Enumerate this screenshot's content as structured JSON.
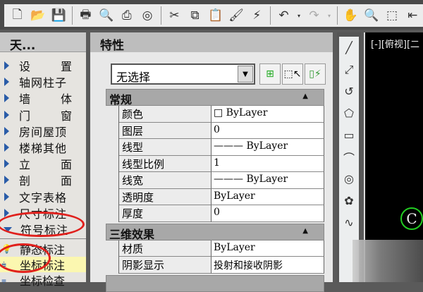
{
  "toolbar": {
    "icons": [
      "new-file-icon",
      "open-folder-icon",
      "save-icon",
      "print-icon",
      "print-preview-icon",
      "publish-icon",
      "3d-dwf-icon",
      "cut-icon",
      "copy-icon",
      "paste-icon",
      "match-properties-icon",
      "block-editor-icon",
      "undo-icon",
      "redo-icon",
      "pan-icon",
      "zoom-realtime-icon",
      "zoom-window-icon",
      "zoom-previous-icon"
    ]
  },
  "left_panel": {
    "title": "天...",
    "items": [
      {
        "label": "设置",
        "expanded": false
      },
      {
        "label": "轴网柱子",
        "expanded": false
      },
      {
        "label": "墙体",
        "expanded": false
      },
      {
        "label": "门窗",
        "expanded": false
      },
      {
        "label": "房间屋顶",
        "expanded": false
      },
      {
        "label": "楼梯其他",
        "expanded": false
      },
      {
        "label": "立面",
        "expanded": false
      },
      {
        "label": "剖面",
        "expanded": false
      },
      {
        "label": "文字表格",
        "expanded": false
      },
      {
        "label": "尺寸标注",
        "expanded": false
      },
      {
        "label": "符号标注",
        "expanded": true
      }
    ],
    "sub_items": [
      {
        "label": "静态标注"
      },
      {
        "label": "坐标标注",
        "highlighted": true
      },
      {
        "label": "坐标检查"
      }
    ]
  },
  "properties": {
    "title": "特性",
    "selection": "无选择",
    "sections": [
      {
        "title": "常规",
        "rows": [
          [
            "颜色",
            "□ ByLayer"
          ],
          [
            "图层",
            "0"
          ],
          [
            "线型",
            "——— ByLayer"
          ],
          [
            "线型比例",
            "1"
          ],
          [
            "线宽",
            "——— ByLayer"
          ],
          [
            "透明度",
            "ByLayer"
          ],
          [
            "厚度",
            "0"
          ]
        ]
      },
      {
        "title": "三维效果",
        "rows": [
          [
            "材质",
            "ByLayer"
          ],
          [
            "阴影显示",
            "投射和接收阴影"
          ]
        ]
      }
    ]
  },
  "canvas": {
    "viewport_label": "[-][俯视][二",
    "ucs_label": "C"
  },
  "colors": {
    "accent": "#2a5ca8",
    "highlight": "#fbf7b0",
    "annotation": "#e0201c",
    "ucs": "#22cc22"
  }
}
